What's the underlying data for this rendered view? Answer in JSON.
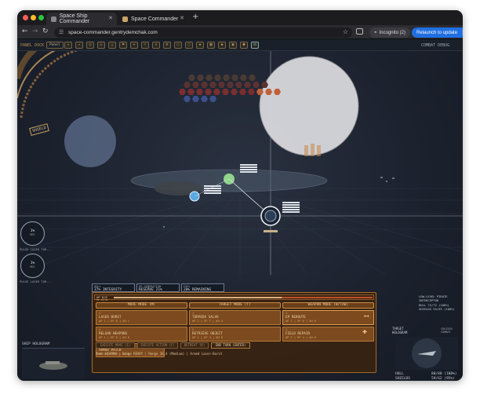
{
  "browser": {
    "tabs": [
      {
        "title": "Space Ship Commander"
      },
      {
        "title": "Space Commander"
      }
    ],
    "url": "space-commander.gentrydemchak.com",
    "incognito_label": "Incognito (2)",
    "relaunch_label": "Relaunch to update",
    "colors": {
      "relaunch": "#1f6fe0",
      "close": "#ff5f57",
      "min": "#febc2e",
      "max": "#28c840"
    }
  },
  "game": {
    "toolbar": {
      "panel_dock": "PANEL DOCK",
      "panel_badge": "Panel",
      "combat_debug": "COMBAT DEBUG"
    },
    "shield_label": "SHIELD",
    "gauges": [
      {
        "value": "1%",
        "sub": "RDY",
        "caption": "PULSE LASER TUR..."
      },
      {
        "value": "1%",
        "sub": "RDY",
        "caption": "PULSE LASER TUR..."
      }
    ],
    "status": {
      "hull": "HULL",
      "hull_value": "37% INTEGRITY",
      "ep_gen": "EP GENERATION",
      "ep_gen_value": "RESERVE 21%",
      "fuel": "FUEL",
      "fuel_value": "20% REMAINING"
    },
    "ap_bar": {
      "label": "AP 8/8",
      "ep": "EP 32/34"
    },
    "columns": [
      {
        "title": "MOVE MODE (M)"
      },
      {
        "title": "TARGET MODE (T)"
      },
      {
        "title": "WEAPON MODE (W/TAB)"
      }
    ],
    "actions": {
      "move": [
        {
          "key": "1",
          "name": "LASER BURST",
          "cost": "AP 1 | EP 8 | AH 1"
        },
        {
          "key": "2",
          "name": "RELOAD WEAPONS",
          "cost": "AP 1 | EP 0 | AH 0"
        },
        {
          "key": "3",
          "name": "ARMOR PATCH",
          "cost": "AP 2 | EP 6 | AH 0"
        }
      ],
      "target": [
        {
          "key": "1",
          "name": "TORPEDO SALVO",
          "cost": "AP 2 | EP 7 | AH 4"
        },
        {
          "key": "2",
          "name": "RETRIEVE OBJECT",
          "cost": "AP 1 | EP 3 | AH 0"
        }
      ],
      "weapon": [
        {
          "key": "1",
          "name": "EP REROUTE",
          "cost": "AP 1 | EP 0 | AH 0"
        },
        {
          "key": "2",
          "name": "FIELD REPAIR",
          "cost": "AP 2 | EP 4 | AH 0"
        }
      ]
    },
    "controls": [
      "EXECUTE MOVE (E)",
      "EXECUTE ACTION (F)",
      "RETREAT (R)",
      "END TURN (ENTER)"
    ],
    "mode_line": "Mode WEAPON | Stage READY | Range 26.4 (Medium) | Armed Laser-Burst",
    "ship_hologram": "SHIP HOLOGRAM",
    "target": {
      "title": "TARGET HOLOGRAM",
      "detail": "CRUISER COMBAT",
      "name": "LOW-LEVEL PIRATE INTERCEPTOR",
      "hull": "HULL 72/72 (100%)",
      "shields": "SHIELDS 55/55 (100%)",
      "hull_bottom_label": "HULL",
      "hull_bottom_value": "80/80 (100%)",
      "shields_bottom_label": "SHIELDS",
      "shields_bottom_value": "59/62 (95%)"
    }
  }
}
